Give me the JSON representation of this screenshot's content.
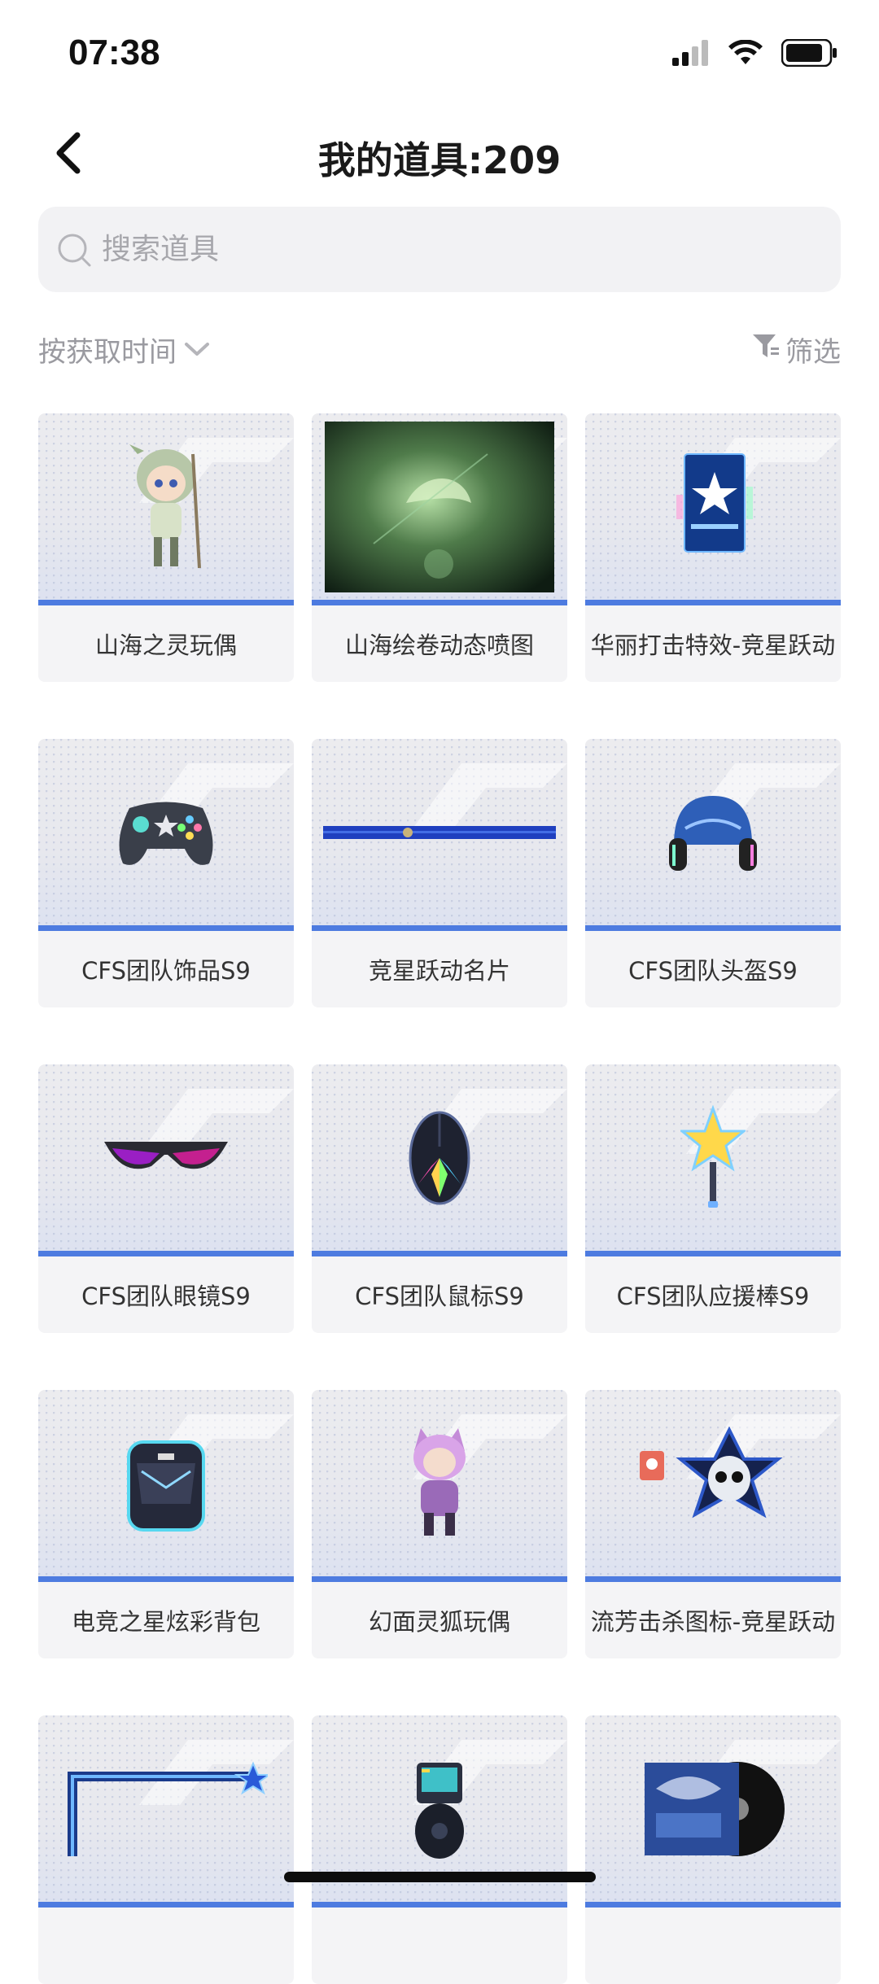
{
  "status_bar": {
    "time": "07:38"
  },
  "header": {
    "title": "我的道具:209",
    "back_icon": "chevron-left-icon"
  },
  "search": {
    "placeholder": "搜索道具",
    "value": ""
  },
  "sort": {
    "label": "按获取时间"
  },
  "filter": {
    "label": "筛选"
  },
  "colors": {
    "accent": "#4d7be0",
    "card_bg": "#f4f4f6",
    "muted_text": "#9a9aa0"
  },
  "items": [
    {
      "name": "山海之灵玩偶",
      "icon": "elf-doll-icon"
    },
    {
      "name": "山海绘卷动态喷图",
      "icon": "animated-spray-icon"
    },
    {
      "name": "华丽打击特效-竞星跃动",
      "icon": "effect-box-icon"
    },
    {
      "name": "CFS团队饰品S9",
      "icon": "gamepad-icon"
    },
    {
      "name": "竞星跃动名片",
      "icon": "name-card-icon"
    },
    {
      "name": "CFS团队头盔S9",
      "icon": "headset-icon"
    },
    {
      "name": "CFS团队眼镜S9",
      "icon": "glasses-icon"
    },
    {
      "name": "CFS团队鼠标S9",
      "icon": "mouse-icon"
    },
    {
      "name": "CFS团队应援棒S9",
      "icon": "star-wand-icon"
    },
    {
      "name": "电竞之星炫彩背包",
      "icon": "backpack-icon"
    },
    {
      "name": "幻面灵狐玩偶",
      "icon": "fox-doll-icon"
    },
    {
      "name": "流芳击杀图标-竞星跃动",
      "icon": "skull-badge-icon"
    },
    {
      "name": "",
      "icon": "frame-icon"
    },
    {
      "name": "",
      "icon": "gadget-icon"
    },
    {
      "name": "",
      "icon": "music-album-icon"
    }
  ]
}
